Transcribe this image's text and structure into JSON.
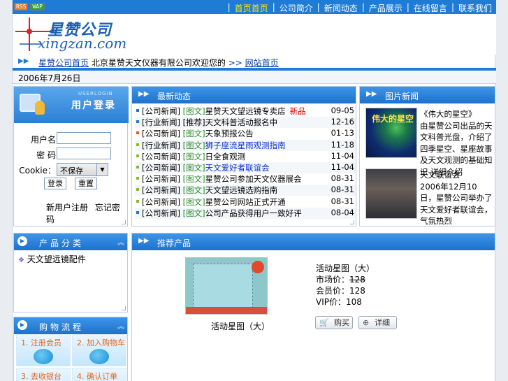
{
  "topbar": {
    "badges": [
      "RSS",
      "WAP"
    ],
    "nav": [
      {
        "label": "首页首页",
        "active": true
      },
      {
        "label": "公司简介",
        "active": false
      },
      {
        "label": "新闻动态",
        "active": false
      },
      {
        "label": "产品展示",
        "active": false
      },
      {
        "label": "在线留言",
        "active": false
      },
      {
        "label": "联系我们",
        "active": false
      }
    ]
  },
  "logo": {
    "cn": "星赞公司",
    "en": "xingzan.com"
  },
  "breadcrumb": {
    "link": "星赞公司首页",
    "text": "北京星赞天文仪器有限公司欢迎您的",
    "sep": ">>",
    "current": "网站首页"
  },
  "date": "2006年7月26日",
  "login": {
    "en_title": "USERLOGIN",
    "title": "用户登录",
    "username_label": "用户名",
    "password_label": "密 码",
    "cookie_label": "Cookie：",
    "cookie_value": "不保存",
    "login_button": "登录",
    "reset_button": "重置",
    "register_link": "新用户注册",
    "forgot_link": "忘记密码"
  },
  "news": {
    "title": "最新动态",
    "items": [
      {
        "cat": "[公司新闻]",
        "tag": "[图文]",
        "title": "星赞天文望远镜专卖店",
        "hot": "新品",
        "date": "09-05",
        "bullet": "#2a6fd6"
      },
      {
        "cat": "[行业新闻]",
        "tag": "[推荐]",
        "title": "天文科普活动报名中",
        "hot": "",
        "date": "12-16",
        "bullet": "#2a6fd6"
      },
      {
        "cat": "[公司新闻]",
        "tag": "[图文]",
        "title": "天象预报公告",
        "hot": "",
        "date": "01-13",
        "bullet": "#e05a1a"
      },
      {
        "cat": "[行业新闻]",
        "tag": "[图文]",
        "title": "狮子座流星雨观测指南",
        "hot": "",
        "date": "11-18",
        "bullet": "#8ab82a",
        "blue": true
      },
      {
        "cat": "[公司新闻]",
        "tag": "[图文]",
        "title": "日全食观测",
        "hot": "",
        "date": "11-04",
        "bullet": "#8ab82a"
      },
      {
        "cat": "[公司新闻]",
        "tag": "[图文]",
        "title": "天文爱好者联谊会",
        "hot": "",
        "date": "11-04",
        "bullet": "#8ab82a",
        "blue": true
      },
      {
        "cat": "[公司新闻]",
        "tag": "[图文]",
        "title": "星赞公司参加天文仪器展会",
        "hot": "",
        "date": "08-31",
        "bullet": "#8ab82a"
      },
      {
        "cat": "[公司新闻]",
        "tag": "[图文]",
        "title": "天文望远镜选购指南",
        "hot": "",
        "date": "08-31",
        "bullet": "#8ab82a"
      },
      {
        "cat": "[公司新闻]",
        "tag": "[图文]",
        "title": "星赞公司网站正式开通",
        "hot": "",
        "date": "08-31",
        "bullet": "#8ab82a"
      },
      {
        "cat": "[公司新闻]",
        "tag": "[图文]",
        "title": "公司产品获得用户一致好评",
        "hot": "",
        "date": "08-04",
        "bullet": "#2a6fd6"
      }
    ]
  },
  "recommend": {
    "title": "图片新闻",
    "img1_text": "伟大的星空",
    "items": [
      {
        "title": "《伟大的星空》",
        "desc": "由星赞公司出品的天文科普光盘，介绍了四季星空、星座故事及天文观测的基础知识 详细介绍"
      },
      {
        "title": "天文联谊会",
        "desc": "2006年12月10日，星赞公司举办了天文爱好者联谊会，气氛热烈"
      }
    ]
  },
  "categories": {
    "title": "产品分类",
    "items": [
      "天文望远镜配件"
    ]
  },
  "steps": {
    "title": "购物流程",
    "items": [
      "1. 注册会员",
      "2. 加入购物车",
      "3. 去收银台",
      "4. 确认订单"
    ]
  },
  "product": {
    "section_title": "推荐产品",
    "name": "活动星图（大）",
    "market_label": "市场价：",
    "market_price": "128",
    "member_label": "会员价：",
    "member_price": "128",
    "vip_label": "VIP价：",
    "vip_price": "108",
    "caption": "活动星图（大）",
    "buy_button": "购买",
    "detail_button": "详细"
  },
  "colors": {
    "accent": "#1e7bd6",
    "nav_active": "#ffea00",
    "link": "#0b3fa8"
  }
}
